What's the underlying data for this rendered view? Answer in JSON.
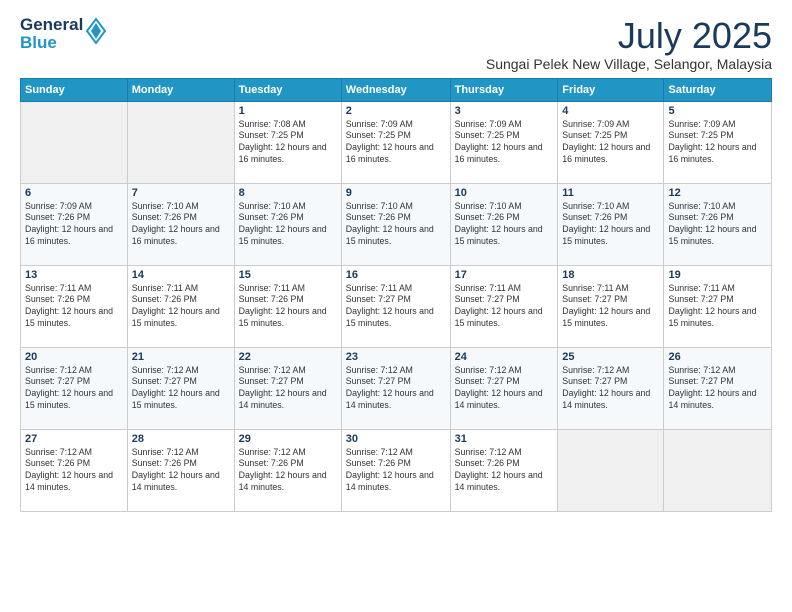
{
  "logo": {
    "line1": "General",
    "line2": "Blue"
  },
  "title": "July 2025",
  "subtitle": "Sungai Pelek New Village, Selangor, Malaysia",
  "headers": [
    "Sunday",
    "Monday",
    "Tuesday",
    "Wednesday",
    "Thursday",
    "Friday",
    "Saturday"
  ],
  "weeks": [
    [
      {
        "day": "",
        "info": ""
      },
      {
        "day": "",
        "info": ""
      },
      {
        "day": "1",
        "info": "Sunrise: 7:08 AM\nSunset: 7:25 PM\nDaylight: 12 hours and 16 minutes."
      },
      {
        "day": "2",
        "info": "Sunrise: 7:09 AM\nSunset: 7:25 PM\nDaylight: 12 hours and 16 minutes."
      },
      {
        "day": "3",
        "info": "Sunrise: 7:09 AM\nSunset: 7:25 PM\nDaylight: 12 hours and 16 minutes."
      },
      {
        "day": "4",
        "info": "Sunrise: 7:09 AM\nSunset: 7:25 PM\nDaylight: 12 hours and 16 minutes."
      },
      {
        "day": "5",
        "info": "Sunrise: 7:09 AM\nSunset: 7:25 PM\nDaylight: 12 hours and 16 minutes."
      }
    ],
    [
      {
        "day": "6",
        "info": "Sunrise: 7:09 AM\nSunset: 7:26 PM\nDaylight: 12 hours and 16 minutes."
      },
      {
        "day": "7",
        "info": "Sunrise: 7:10 AM\nSunset: 7:26 PM\nDaylight: 12 hours and 16 minutes."
      },
      {
        "day": "8",
        "info": "Sunrise: 7:10 AM\nSunset: 7:26 PM\nDaylight: 12 hours and 15 minutes."
      },
      {
        "day": "9",
        "info": "Sunrise: 7:10 AM\nSunset: 7:26 PM\nDaylight: 12 hours and 15 minutes."
      },
      {
        "day": "10",
        "info": "Sunrise: 7:10 AM\nSunset: 7:26 PM\nDaylight: 12 hours and 15 minutes."
      },
      {
        "day": "11",
        "info": "Sunrise: 7:10 AM\nSunset: 7:26 PM\nDaylight: 12 hours and 15 minutes."
      },
      {
        "day": "12",
        "info": "Sunrise: 7:10 AM\nSunset: 7:26 PM\nDaylight: 12 hours and 15 minutes."
      }
    ],
    [
      {
        "day": "13",
        "info": "Sunrise: 7:11 AM\nSunset: 7:26 PM\nDaylight: 12 hours and 15 minutes."
      },
      {
        "day": "14",
        "info": "Sunrise: 7:11 AM\nSunset: 7:26 PM\nDaylight: 12 hours and 15 minutes."
      },
      {
        "day": "15",
        "info": "Sunrise: 7:11 AM\nSunset: 7:26 PM\nDaylight: 12 hours and 15 minutes."
      },
      {
        "day": "16",
        "info": "Sunrise: 7:11 AM\nSunset: 7:27 PM\nDaylight: 12 hours and 15 minutes."
      },
      {
        "day": "17",
        "info": "Sunrise: 7:11 AM\nSunset: 7:27 PM\nDaylight: 12 hours and 15 minutes."
      },
      {
        "day": "18",
        "info": "Sunrise: 7:11 AM\nSunset: 7:27 PM\nDaylight: 12 hours and 15 minutes."
      },
      {
        "day": "19",
        "info": "Sunrise: 7:11 AM\nSunset: 7:27 PM\nDaylight: 12 hours and 15 minutes."
      }
    ],
    [
      {
        "day": "20",
        "info": "Sunrise: 7:12 AM\nSunset: 7:27 PM\nDaylight: 12 hours and 15 minutes."
      },
      {
        "day": "21",
        "info": "Sunrise: 7:12 AM\nSunset: 7:27 PM\nDaylight: 12 hours and 15 minutes."
      },
      {
        "day": "22",
        "info": "Sunrise: 7:12 AM\nSunset: 7:27 PM\nDaylight: 12 hours and 14 minutes."
      },
      {
        "day": "23",
        "info": "Sunrise: 7:12 AM\nSunset: 7:27 PM\nDaylight: 12 hours and 14 minutes."
      },
      {
        "day": "24",
        "info": "Sunrise: 7:12 AM\nSunset: 7:27 PM\nDaylight: 12 hours and 14 minutes."
      },
      {
        "day": "25",
        "info": "Sunrise: 7:12 AM\nSunset: 7:27 PM\nDaylight: 12 hours and 14 minutes."
      },
      {
        "day": "26",
        "info": "Sunrise: 7:12 AM\nSunset: 7:27 PM\nDaylight: 12 hours and 14 minutes."
      }
    ],
    [
      {
        "day": "27",
        "info": "Sunrise: 7:12 AM\nSunset: 7:26 PM\nDaylight: 12 hours and 14 minutes."
      },
      {
        "day": "28",
        "info": "Sunrise: 7:12 AM\nSunset: 7:26 PM\nDaylight: 12 hours and 14 minutes."
      },
      {
        "day": "29",
        "info": "Sunrise: 7:12 AM\nSunset: 7:26 PM\nDaylight: 12 hours and 14 minutes."
      },
      {
        "day": "30",
        "info": "Sunrise: 7:12 AM\nSunset: 7:26 PM\nDaylight: 12 hours and 14 minutes."
      },
      {
        "day": "31",
        "info": "Sunrise: 7:12 AM\nSunset: 7:26 PM\nDaylight: 12 hours and 14 minutes."
      },
      {
        "day": "",
        "info": ""
      },
      {
        "day": "",
        "info": ""
      }
    ]
  ]
}
